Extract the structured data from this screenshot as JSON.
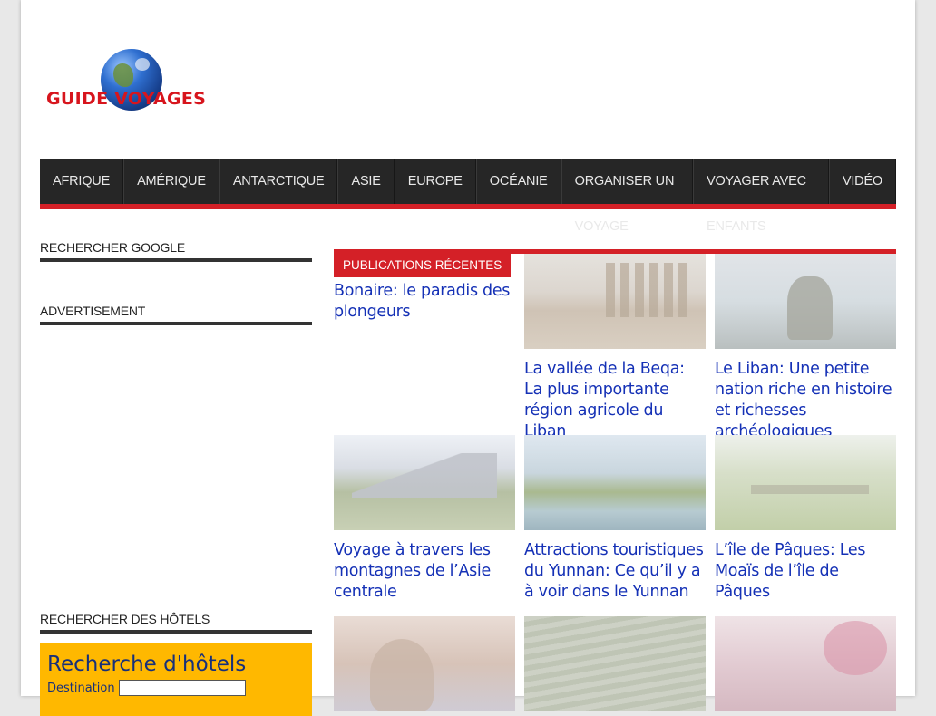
{
  "logo": {
    "text": "GUIDE VOYAGES"
  },
  "nav": {
    "items": [
      "AFRIQUE",
      "AMÉRIQUE",
      "ANTARCTIQUE",
      "ASIE",
      "EUROPE",
      "OCÉANIE",
      "ORGANISER UN VOYAGE",
      "VOYAGER AVEC ENFANTS",
      "VIDÉO"
    ]
  },
  "sidebar": {
    "google_title": "RECHERCHER GOOGLE",
    "ad_title": "ADVERTISEMENT",
    "hotels_title": "RECHERCHER DES HÔTELS",
    "hotel_search": {
      "heading": "Recherche d'hôtels",
      "destination_label": "Destination",
      "destination_value": ""
    }
  },
  "main": {
    "section_tag": "PUBLICATIONS RÉCENTES",
    "posts": [
      {
        "title": "Bonaire: le paradis des plongeurs"
      },
      {
        "title": "La vallée de la Beqa: La plus importante région agricole du Liban"
      },
      {
        "title": "Le Liban: Une petite nation riche en histoire et richesses archéologiques"
      },
      {
        "title": "Voyage à travers les montagnes de l’Asie centrale"
      },
      {
        "title": "Attractions touristiques du Yunnan: Ce qu’il y a à voir dans le Yunnan"
      },
      {
        "title": "L’île de Pâques: Les Moaïs de l’île de Pâques"
      }
    ]
  },
  "colors": {
    "accent": "#d42027",
    "nav_bg": "#262626",
    "link": "#1531b6",
    "hotel_box": "#ffb800"
  }
}
